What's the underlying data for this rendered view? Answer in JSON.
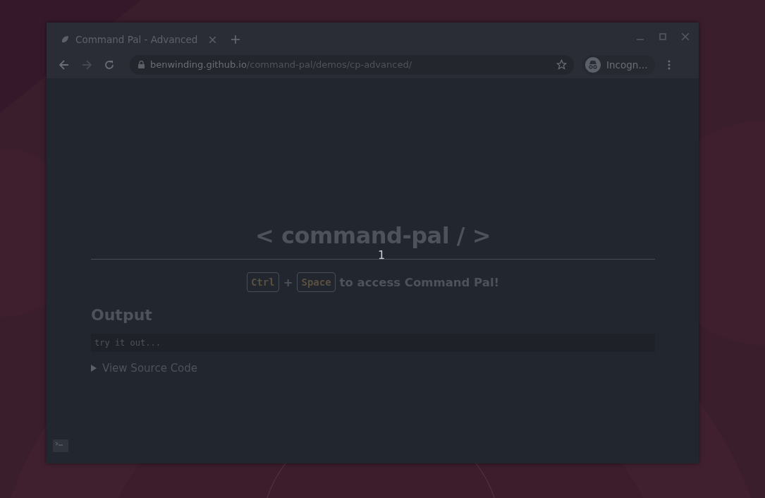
{
  "window": {
    "tab_title": "Command Pal - Advanced",
    "url_host": "benwinding.github.io",
    "url_path": "/command-pal/demos/cp-advanced/",
    "profile": "Incogn…"
  },
  "page": {
    "heading": "< command-pal / >",
    "overlay_text": "1",
    "shortcut": {
      "keys": [
        "Ctrl",
        "Space"
      ],
      "joiner": "+",
      "text": "to access Command Pal!"
    },
    "output_title": "Output",
    "output_placeholder": "try it out...",
    "details": {
      "summary": "View Source Code",
      "expanded": false
    }
  }
}
